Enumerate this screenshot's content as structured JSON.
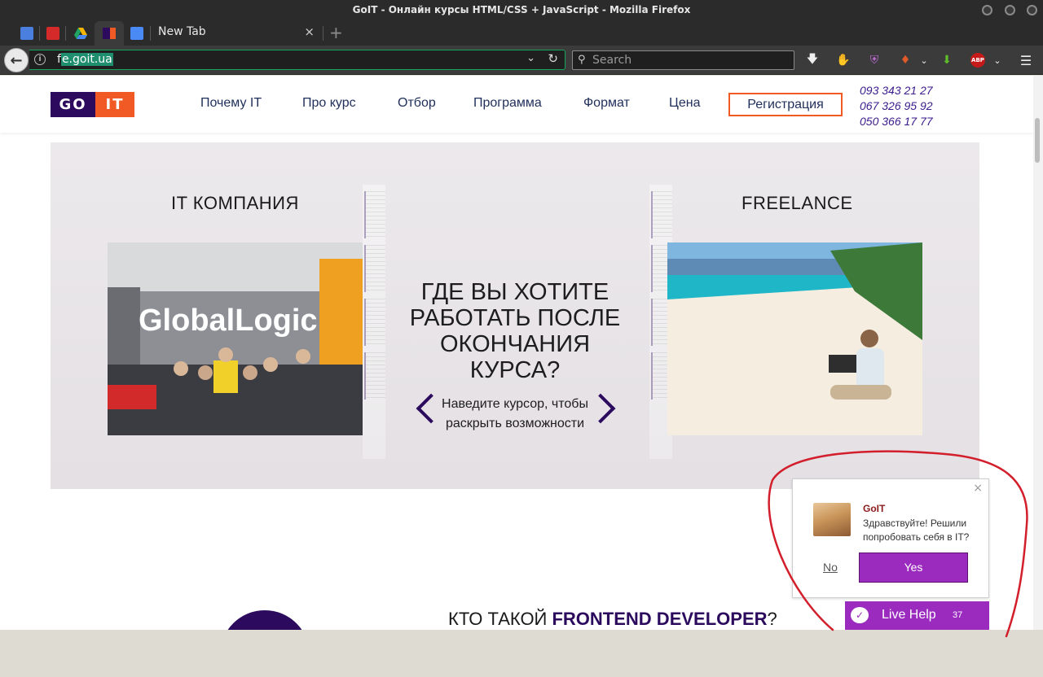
{
  "window": {
    "title": "GoIT - Онлайн курсы HTML/CSS + JavaScript - Mozilla Firefox"
  },
  "tabs": {
    "active_label": "New Tab",
    "close_symbol": "×",
    "new_tab_symbol": "+"
  },
  "navbar": {
    "url_prefix": "f",
    "url_selected": "e.goit.ua",
    "search_placeholder": "Search"
  },
  "site": {
    "logo": {
      "part1": "GO",
      "part2": "IT"
    },
    "nav": [
      "Почему IT",
      "Про курс",
      "Отбор",
      "Программа",
      "Формат",
      "Цена"
    ],
    "register_label": "Регистрация",
    "phones": [
      "093 343 21 27",
      "067 326 95 92",
      "050 366 17 77"
    ]
  },
  "hero": {
    "left_title": "IT КОМПАНИЯ",
    "right_title": "FREELANCE",
    "image_left_text": "GlobalLogic",
    "question": "ГДЕ ВЫ ХОТИТЕ РАБОТАТЬ ПОСЛЕ ОКОНЧАНИЯ КУРСА?",
    "hint": "Наведите курсор, чтобы раскрыть возможности"
  },
  "section": {
    "who_prefix": "КТО ТАКОЙ ",
    "who_highlight": "FRONTEND DEVELOPER",
    "who_suffix": "?"
  },
  "chat": {
    "name": "GoIT",
    "message": "Здравствуйте! Решили попробовать себя в IT?",
    "no_label": "No",
    "yes_label": "Yes",
    "close_symbol": "×",
    "livehelp_label": "Live Help",
    "livehelp_count": "37"
  },
  "colors": {
    "brand_purple": "#2c0b5f",
    "brand_orange": "#f15a24",
    "chat_purple": "#9b2bbf",
    "annotation_red": "#d21f2b"
  }
}
